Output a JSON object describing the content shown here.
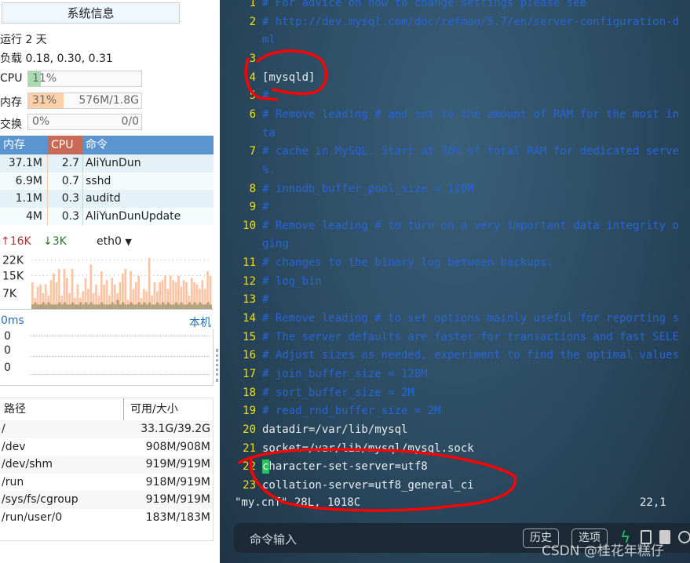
{
  "sidebar": {
    "title": "系统信息",
    "uptime": "运行 2 天",
    "load": "负载 0.18, 0.30, 0.31",
    "cpu": {
      "label": "CPU",
      "percent_text": "11%",
      "percent": 11,
      "color": "#a8dcb0"
    },
    "mem": {
      "label": "内存",
      "percent_text": "31%",
      "percent": 31,
      "usage": "576M/1.8G",
      "color": "#fdd0aa"
    },
    "swap": {
      "label": "交换",
      "percent_text": "0%",
      "percent": 0,
      "usage": "0/0"
    },
    "processes": {
      "headers": [
        "内存",
        "CPU",
        "命令"
      ],
      "rows": [
        [
          "37.1M",
          "2.7",
          "AliYunDun"
        ],
        [
          "6.9M",
          "0.7",
          "sshd"
        ],
        [
          "1.1M",
          "0.3",
          "auditd"
        ],
        [
          "4M",
          "0.3",
          "AliYunDunUpdate"
        ]
      ]
    },
    "network": {
      "up": "16K",
      "down": "3K",
      "interface": "eth0",
      "y_ticks": [
        "22K",
        "15K",
        "7K"
      ],
      "up_values": [
        12,
        5,
        10,
        11,
        7,
        11,
        6,
        13,
        16,
        12,
        18,
        6,
        18,
        14,
        7,
        18,
        5,
        11,
        5,
        8,
        14,
        9,
        20,
        7,
        11,
        6,
        17,
        11,
        13,
        6,
        14,
        11,
        7,
        12,
        16,
        18,
        4,
        17,
        9,
        12,
        15,
        5,
        9,
        8,
        23,
        6,
        12,
        8,
        12,
        13,
        15,
        9,
        15,
        13,
        12,
        15,
        10,
        13,
        12,
        6,
        14,
        12,
        11,
        9,
        13,
        9,
        17,
        15
      ],
      "down_values": [
        2,
        3,
        2,
        2,
        3,
        2,
        3,
        2,
        2,
        2,
        3,
        2,
        3,
        2,
        2,
        3,
        2,
        2,
        3,
        2,
        3,
        2,
        3,
        2,
        2,
        2,
        3,
        2,
        2,
        2,
        3,
        2,
        4,
        2,
        3,
        2,
        2,
        3,
        2,
        2,
        3,
        2,
        3,
        2,
        3,
        2,
        2,
        3,
        2,
        3,
        2,
        3,
        2,
        2,
        3,
        2,
        3,
        2,
        2,
        3,
        2,
        3,
        2,
        3,
        2,
        2,
        3,
        2
      ],
      "colors": {
        "up": "#fcc3a4",
        "down": "#b3a07c"
      }
    },
    "ping": {
      "latency": "0ms",
      "host": "本机",
      "values": [
        "0",
        "0",
        "0"
      ]
    },
    "disks": {
      "headers": [
        "路径",
        "可用/大小"
      ],
      "rows": [
        [
          "/",
          "33.1G/39.2G"
        ],
        [
          "/dev",
          "908M/908M"
        ],
        [
          "/dev/shm",
          "919M/919M"
        ],
        [
          "/run",
          "918M/919M"
        ],
        [
          "/sys/fs/cgroup",
          "919M/919M"
        ],
        [
          "/run/user/0",
          "183M/183M"
        ]
      ]
    }
  },
  "editor": {
    "lines": [
      {
        "n": "1",
        "t": "# For advice on how to change settings please see",
        "k": "cmt"
      },
      {
        "n": "2",
        "t": "# http://dev.mysql.com/doc/refman/5.7/en/server-configuration-d",
        "k": "cmt"
      },
      {
        "n": "",
        "t": "ml",
        "k": "cmt"
      },
      {
        "n": "3",
        "t": "",
        "k": "code"
      },
      {
        "n": "4",
        "t": "[mysqld]",
        "k": "code"
      },
      {
        "n": "5",
        "t": "#",
        "k": "cmt"
      },
      {
        "n": "6",
        "t": "# Remove leading # and set to the amount of RAM for the most in",
        "k": "cmt"
      },
      {
        "n": "",
        "t": "ta",
        "k": "cmt"
      },
      {
        "n": "7",
        "t": "# cache in MySQL. Start at 70% of total RAM for dedicated serve",
        "k": "cmt"
      },
      {
        "n": "",
        "t": "%.",
        "k": "cmt"
      },
      {
        "n": "8",
        "t": "# innodb_buffer_pool_size = 128M",
        "k": "cmt"
      },
      {
        "n": "9",
        "t": "#",
        "k": "cmt"
      },
      {
        "n": "10",
        "t": "# Remove leading # to turn on a very important data integrity o",
        "k": "cmt"
      },
      {
        "n": "",
        "t": "ging",
        "k": "cmt"
      },
      {
        "n": "11",
        "t": "# changes to the binary log between backups.",
        "k": "cmt"
      },
      {
        "n": "12",
        "t": "# log_bin",
        "k": "cmt"
      },
      {
        "n": "13",
        "t": "#",
        "k": "cmt"
      },
      {
        "n": "14",
        "t": "# Remove leading # to set options mainly useful for reporting s",
        "k": "cmt"
      },
      {
        "n": "15",
        "t": "# The server defaults are faster for transactions and fast SELE",
        "k": "cmt"
      },
      {
        "n": "16",
        "t": "# Adjust sizes as needed, experiment to find the optimal values",
        "k": "cmt"
      },
      {
        "n": "17",
        "t": "# join_buffer_size = 128M",
        "k": "cmt"
      },
      {
        "n": "18",
        "t": "# sort_buffer_size = 2M",
        "k": "cmt"
      },
      {
        "n": "19",
        "t": "# read_rnd_buffer_size = 2M",
        "k": "cmt"
      },
      {
        "n": "20",
        "t": "datadir=/var/lib/mysql",
        "k": "code"
      },
      {
        "n": "21",
        "t": "socket=/var/lib/mysql/mysql.sock",
        "k": "code"
      },
      {
        "n": "22",
        "t": "character-set-server=utf8",
        "k": "code"
      },
      {
        "n": "23",
        "t": "collation-server=utf8_general_ci",
        "k": "code"
      }
    ],
    "status_file": "\"my.cnf\" 28L, 1018C",
    "status_pos": "22,1",
    "cursor_color": "#22c55e"
  },
  "cmdbar": {
    "placeholder": "命令输入",
    "history": "历史",
    "options": "选项"
  },
  "watermark": "CSDN @桂花年糕仔",
  "annotation_color": "#ff0000"
}
